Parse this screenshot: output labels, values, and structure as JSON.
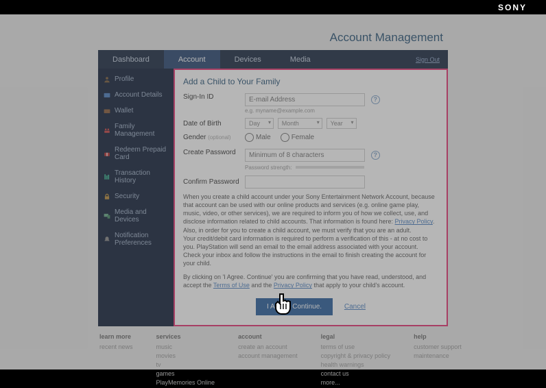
{
  "brand": "SONY",
  "header": {
    "title": "Account Management"
  },
  "tabs": [
    {
      "label": "Dashboard"
    },
    {
      "label": "Account"
    },
    {
      "label": "Devices"
    },
    {
      "label": "Media"
    }
  ],
  "signout": "Sign Out",
  "sidebar": {
    "items": [
      {
        "label": "Profile",
        "icon": "user-icon"
      },
      {
        "label": "Account Details",
        "icon": "card-icon"
      },
      {
        "label": "Wallet",
        "icon": "wallet-icon"
      },
      {
        "label": "Family Management",
        "icon": "family-icon"
      },
      {
        "label": "Redeem Prepaid Card",
        "icon": "gift-icon"
      },
      {
        "label": "Transaction History",
        "icon": "history-icon"
      },
      {
        "label": "Security",
        "icon": "lock-icon"
      },
      {
        "label": "Media and Devices",
        "icon": "devices-icon"
      },
      {
        "label": "Notification Preferences",
        "icon": "bell-icon"
      }
    ]
  },
  "main": {
    "heading": "Add a Child to Your Family",
    "signin_id_label": "Sign-In ID",
    "signin_id_placeholder": "E-mail Address",
    "signin_id_hint": "e.g. myname@example.com",
    "dob_label": "Date of Birth",
    "dob_day": "Day",
    "dob_month": "Month",
    "dob_year": "Year",
    "gender_label": "Gender",
    "gender_optional": "(optional)",
    "gender_male": "Male",
    "gender_female": "Female",
    "create_pw_label": "Create Password",
    "create_pw_placeholder": "Minimum of 8 characters",
    "pw_strength_label": "Password strength:",
    "confirm_pw_label": "Confirm Password",
    "info_text_1a": "When you create a child account under your Sony Entertainment Network Account, because that account can be used with our online products and services (e.g. online game play, music, video, or other services), we are required to inform you of how we collect, use, and disclose information related to child accounts. That information is found here: ",
    "info_link_privacy": "Privacy Policy",
    "info_text_1b": ".",
    "info_text_2": "Also, in order for you to create a child account, we must verify that you are an adult.",
    "info_text_3": "Your credit/debit card information is required to perform a verification of this - at no cost to you. PlayStation will send an email to the email address associated with your account.",
    "info_text_4": "Check your inbox and follow the instructions in the email to finish creating the account for your child.",
    "info_text_5a": "By clicking on 'I Agree. Continue' you are confirming that you have read, understood, and accept the ",
    "info_link_terms": "Terms of Use",
    "info_text_5b": " and the ",
    "info_text_5c": " that apply to your child's account.",
    "agree_btn": "I Agree. Continue.",
    "cancel": "Cancel"
  },
  "footer": {
    "cols": [
      {
        "title": "learn more",
        "links": [
          "recent news"
        ]
      },
      {
        "title": "services",
        "links": [
          "music",
          "movies",
          "tv",
          "games",
          "PlayMemories Online"
        ]
      },
      {
        "title": "account",
        "links": [
          "create an account",
          "account management"
        ]
      },
      {
        "title": "legal",
        "links": [
          "terms of use",
          "copyright & privacy policy",
          "health warnings",
          "contact us",
          "more..."
        ]
      },
      {
        "title": "help",
        "links": [
          "customer support",
          "maintenance"
        ]
      }
    ]
  }
}
